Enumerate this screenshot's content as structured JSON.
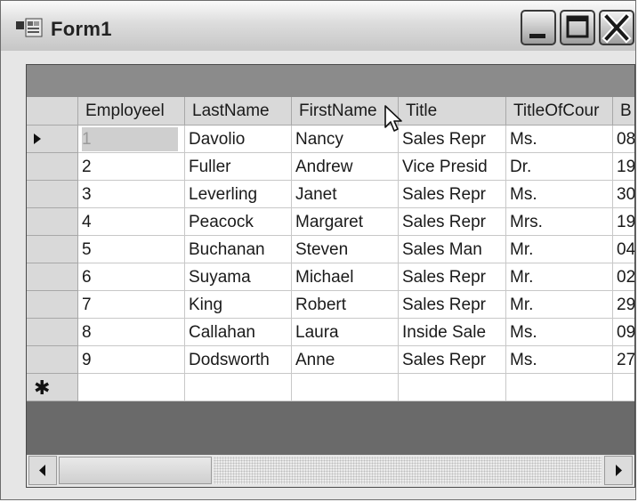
{
  "window": {
    "title": "Form1"
  },
  "grid": {
    "columns": [
      "Employeel",
      "LastName",
      "FirstName",
      "Title",
      "TitleOfCour",
      "B"
    ],
    "rows": [
      [
        "1",
        "Davolio",
        "Nancy",
        "Sales Repr",
        "Ms.",
        "08"
      ],
      [
        "2",
        "Fuller",
        "Andrew",
        "Vice Presid",
        "Dr.",
        "19"
      ],
      [
        "3",
        "Leverling",
        "Janet",
        "Sales Repr",
        "Ms.",
        "30"
      ],
      [
        "4",
        "Peacock",
        "Margaret",
        "Sales Repr",
        "Mrs.",
        "19"
      ],
      [
        "5",
        "Buchanan",
        "Steven",
        "Sales Man",
        "Mr.",
        "04"
      ],
      [
        "6",
        "Suyama",
        "Michael",
        "Sales Repr",
        "Mr.",
        "02"
      ],
      [
        "7",
        "King",
        "Robert",
        "Sales Repr",
        "Mr.",
        "29"
      ],
      [
        "8",
        "Callahan",
        "Laura",
        "Inside Sale",
        "Ms.",
        "09"
      ],
      [
        "9",
        "Dodsworth",
        "Anne",
        "Sales Repr",
        "Ms.",
        "27"
      ]
    ],
    "current_row_marker": "▶",
    "new_row_marker": "✱"
  }
}
